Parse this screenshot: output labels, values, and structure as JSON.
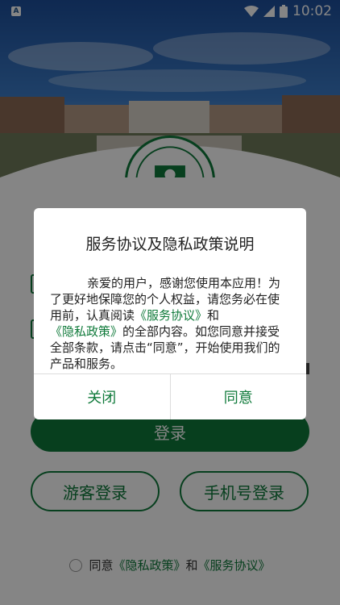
{
  "status_bar": {
    "app_badge": "A",
    "time": "10:02"
  },
  "login": {
    "main_button": "登录",
    "guest_button": "游客登录",
    "phone_button": "手机号登录",
    "consent_prefix": "同意",
    "consent_privacy": "《隐私政策》",
    "consent_and": "和",
    "consent_service": "《服务协议》"
  },
  "dialog": {
    "title": "服务协议及隐私政策说明",
    "body_1": "亲爱的用户，感谢您使用本应用！为了更好地保障您的个人权益，请您务必在使用前，认真阅读",
    "body_service": "《服务协议》",
    "body_and": "和",
    "body_privacy": "《隐私政策》",
    "body_2": "的全部内容。如您同意并接受全部条款，请点击“同意”，开始使用我们的产品和服务。",
    "close_button": "关闭",
    "agree_button": "同意"
  },
  "colors": {
    "brand_green": "#0f7a3a",
    "scrim": "rgba(0,0,0,0.48)"
  }
}
